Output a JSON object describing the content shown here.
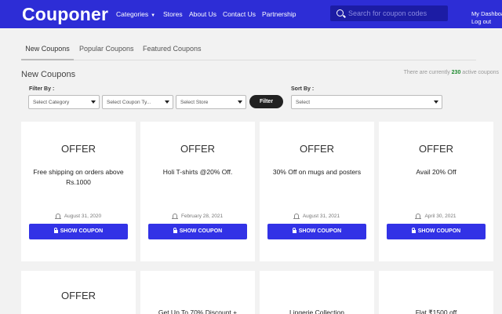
{
  "header": {
    "logo": "Couponer",
    "nav": [
      {
        "label": "Categories",
        "has_dropdown": true
      },
      {
        "label": "Stores"
      },
      {
        "label": "About Us"
      },
      {
        "label": "Contact Us"
      },
      {
        "label": "Partnership"
      }
    ],
    "search_placeholder": "Search for coupon codes",
    "account": {
      "dashboard": "My Dashboa",
      "logout": "Log out"
    }
  },
  "tabs": [
    {
      "label": "New Coupons",
      "active": true
    },
    {
      "label": "Popular Coupons"
    },
    {
      "label": "Featured Coupons"
    }
  ],
  "section": {
    "title": "New Coupons",
    "count_prefix": "There are currently",
    "count": "230",
    "count_suffix": "active coupons"
  },
  "filters": {
    "filter_by_label": "Filter By :",
    "category": "Select Category",
    "coupon_type": "Select Coupon Ty...",
    "store": "Select Store",
    "filter_button": "Filter",
    "sort_by_label": "Sort By :",
    "sort": "Select"
  },
  "coupons": [
    {
      "offer": "OFFER",
      "desc": "Free shipping on orders above Rs.1000",
      "date": "August 31, 2020",
      "button": "SHOW COUPON"
    },
    {
      "offer": "OFFER",
      "desc": "Holi T-shirts @20% Off.",
      "date": "February 28, 2021",
      "button": "SHOW COUPON"
    },
    {
      "offer": "OFFER",
      "desc": "30% Off on mugs and posters",
      "date": "August 31, 2021",
      "button": "SHOW COUPON"
    },
    {
      "offer": "OFFER",
      "desc": "Avail 20% Off",
      "date": "April 30, 2021",
      "button": "SHOW COUPON"
    },
    {
      "offer": "OFFER",
      "desc": "",
      "date": "",
      "button": ""
    },
    {
      "offer": "",
      "desc": "Get Up To 70% Discount +",
      "date": "",
      "button": ""
    },
    {
      "offer": "",
      "desc": "Lingerie Collection",
      "date": "",
      "button": ""
    },
    {
      "offer": "",
      "desc": "Flat ₹1500 off",
      "date": "",
      "button": ""
    }
  ],
  "colors": {
    "header_bg": "#2d2dd6",
    "button_bg": "#3232e6",
    "count_green": "#1d8a2e"
  },
  "icons": [
    "search-icon",
    "caret-down-icon",
    "bell-icon",
    "lock-icon",
    "dropdown-arrow-icon"
  ]
}
